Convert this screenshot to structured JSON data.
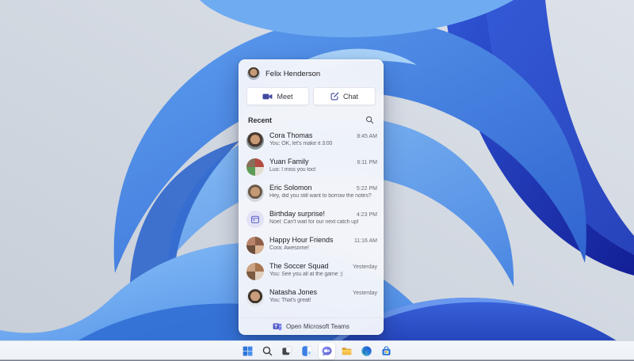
{
  "chat_flyout": {
    "header": {
      "user_name": "Felix Henderson"
    },
    "actions": {
      "meet_label": "Meet",
      "meet_icon": "video-camera-icon",
      "chat_label": "Chat",
      "chat_icon": "compose-icon"
    },
    "recent": {
      "label": "Recent",
      "search_icon": "magnifier-icon"
    },
    "conversations": [
      {
        "name": "Cora Thomas",
        "preview": "You: OK, let's make it 3:00",
        "time": "8:45 AM",
        "avatar": "woman-photo"
      },
      {
        "name": "Yuan Family",
        "preview": "Luo: I miss you too!",
        "time": "6:11 PM",
        "avatar": "group-photo"
      },
      {
        "name": "Eric Solomon",
        "preview": "Hey, did you still want to borrow the notes?",
        "time": "5:22 PM",
        "avatar": "man-photo"
      },
      {
        "name": "Birthday surprise!",
        "preview": "Noel: Can't wait for our next catch up!",
        "time": "4:23 PM",
        "avatar": "calendar-icon"
      },
      {
        "name": "Happy Hour Friends",
        "preview": "Cora: Awesome!",
        "time": "11:16 AM",
        "avatar": "group-photo"
      },
      {
        "name": "The Soccer Squad",
        "preview": "You: See you all at the game :)",
        "time": "Yesterday",
        "avatar": "group-photo"
      },
      {
        "name": "Natasha Jones",
        "preview": "You: That's great!",
        "time": "Yesterday",
        "avatar": "woman-photo"
      }
    ],
    "footer": {
      "label": "Open Microsoft Teams",
      "icon": "teams-logo-icon"
    }
  },
  "taskbar": {
    "items": [
      {
        "icon": "windows-start-icon",
        "active": false
      },
      {
        "icon": "search-icon",
        "active": false
      },
      {
        "icon": "task-view-icon",
        "active": false
      },
      {
        "icon": "widgets-icon",
        "active": false
      },
      {
        "icon": "teams-chat-icon",
        "active": true
      },
      {
        "icon": "file-explorer-icon",
        "active": false
      },
      {
        "icon": "edge-browser-icon",
        "active": false
      },
      {
        "icon": "microsoft-store-icon",
        "active": false
      }
    ]
  },
  "colors": {
    "teams_purple": "#5b5fc7",
    "button_icon_indigo": "#3f479f",
    "bloom_navy": "#16279f",
    "bloom_royal": "#2f63cf",
    "bloom_light": "#8ec4f8",
    "desktop_gray": "#ccd3dc",
    "panel_bg": "#f4f5fa",
    "taskbar_bg": "#f0f3f8"
  }
}
